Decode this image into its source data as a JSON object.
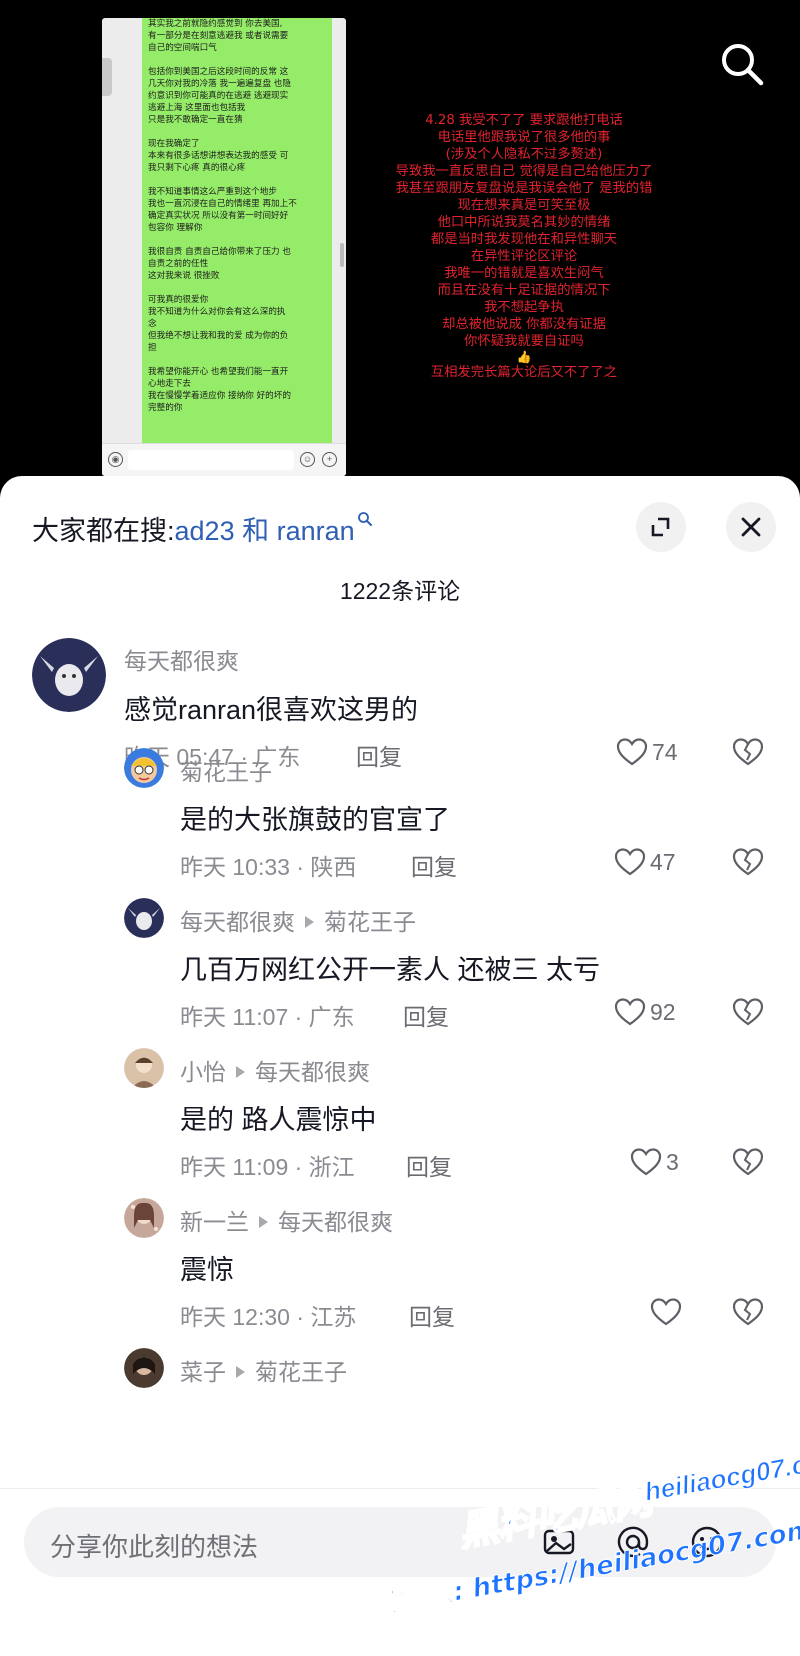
{
  "video": {
    "chat_lines": [
      "其实我之前就隐约感觉到 你去美国,\n有一部分是在刻意逃避我 或者说需要\n自己的空间喘口气",
      "包括你到美国之后这段时间的反常 这\n几天你对我的冷落 我一遍遍复盘 也隐\n约意识到你可能真的在逃避 逃避现实\n逃避上海 这里面也包括我\n只是我不敢确定一直在猜",
      "现在我确定了\n本来有很多话想讲想表达我的感受 可\n我只剩下心疼 真的很心疼",
      "我不知道事情这么严重到这个地步\n我也一直沉浸在自己的情绪里 再加上不\n确定真实状况 所以没有第一时间好好\n包容你 理解你",
      "我很自责 自责自己给你带来了压力 也\n自责之前的任性\n这对我来说 很挫败",
      "可我真的很爱你\n我不知道为什么对你会有这么深的执\n念\n但我绝不想让我和我的爱 成为你的负\n担",
      "我希望你能开心 也希望我们能一直开\n心地走下去\n我在慢慢学着适应你 接纳你 好的坏的\n完整的你"
    ],
    "note_lines": [
      "4.28 我受不了了 要求跟他打电话",
      "电话里他跟我说了很多他的事",
      "(涉及个人隐私不过多赘述)",
      "导致我一直反思自己 觉得是自己给他压力了",
      "我甚至跟朋友复盘说是我误会他了 是我的错",
      "现在想来真是可笑至极",
      "他口中所说我莫名其妙的情绪",
      "都是当时我发现他在和异性聊天",
      "在异性评论区评论",
      "我唯一的错就是喜欢生闷气",
      "而且在没有十足证据的情况下",
      "我不想起争执",
      "却总被他说成 你都没有证据",
      "你怀疑我就要自证吗",
      "👍",
      "互相发完长篇大论后又不了了之"
    ],
    "search_icon": "search-icon"
  },
  "sheet": {
    "hot_search_prefix": "大家都在搜:",
    "hot_search_query": "ad23 和 ranran",
    "comment_count": "1222条评论",
    "comments": [
      {
        "user": "每天都很爽",
        "reply_to": "",
        "text": "感觉ranran很喜欢这男的",
        "time": "昨天 05:47 · 广东",
        "reply_label": "回复",
        "likes": "74",
        "avatar_color": "#2a2f5a"
      },
      {
        "user": "菊花王子",
        "reply_to": "",
        "text": "是的大张旗鼓的官宣了",
        "time": "昨天 10:33 · 陕西",
        "reply_label": "回复",
        "likes": "47",
        "avatar_color": "#3a7be0"
      },
      {
        "user": "每天都很爽",
        "reply_to": "菊花王子",
        "text": "几百万网红公开一素人 还被三 太亏",
        "time": "昨天 11:07 · 广东",
        "reply_label": "回复",
        "likes": "92",
        "avatar_color": "#2a2f5a"
      },
      {
        "user": "小怡",
        "reply_to": "每天都很爽",
        "text": "是的 路人震惊中",
        "time": "昨天 11:09 · 浙江",
        "reply_label": "回复",
        "likes": "3",
        "avatar_color": "#c9a58a"
      },
      {
        "user": "新一兰",
        "reply_to": "每天都很爽",
        "text": "震惊",
        "time": "昨天 12:30 · 江苏",
        "reply_label": "回复",
        "likes": "",
        "avatar_color": "#b98a7a"
      },
      {
        "user": "菜子",
        "reply_to": "菊花王子",
        "text": "",
        "time": "",
        "reply_label": "",
        "likes": "",
        "avatar_color": "#4a3a30"
      }
    ],
    "input_placeholder": "分享你此刻的想法"
  },
  "watermark": {
    "logo": "黑料吃瓜网",
    "url": "heiliaocg07.com",
    "bottom": "看完整版: https://heiliaocg07.com"
  }
}
